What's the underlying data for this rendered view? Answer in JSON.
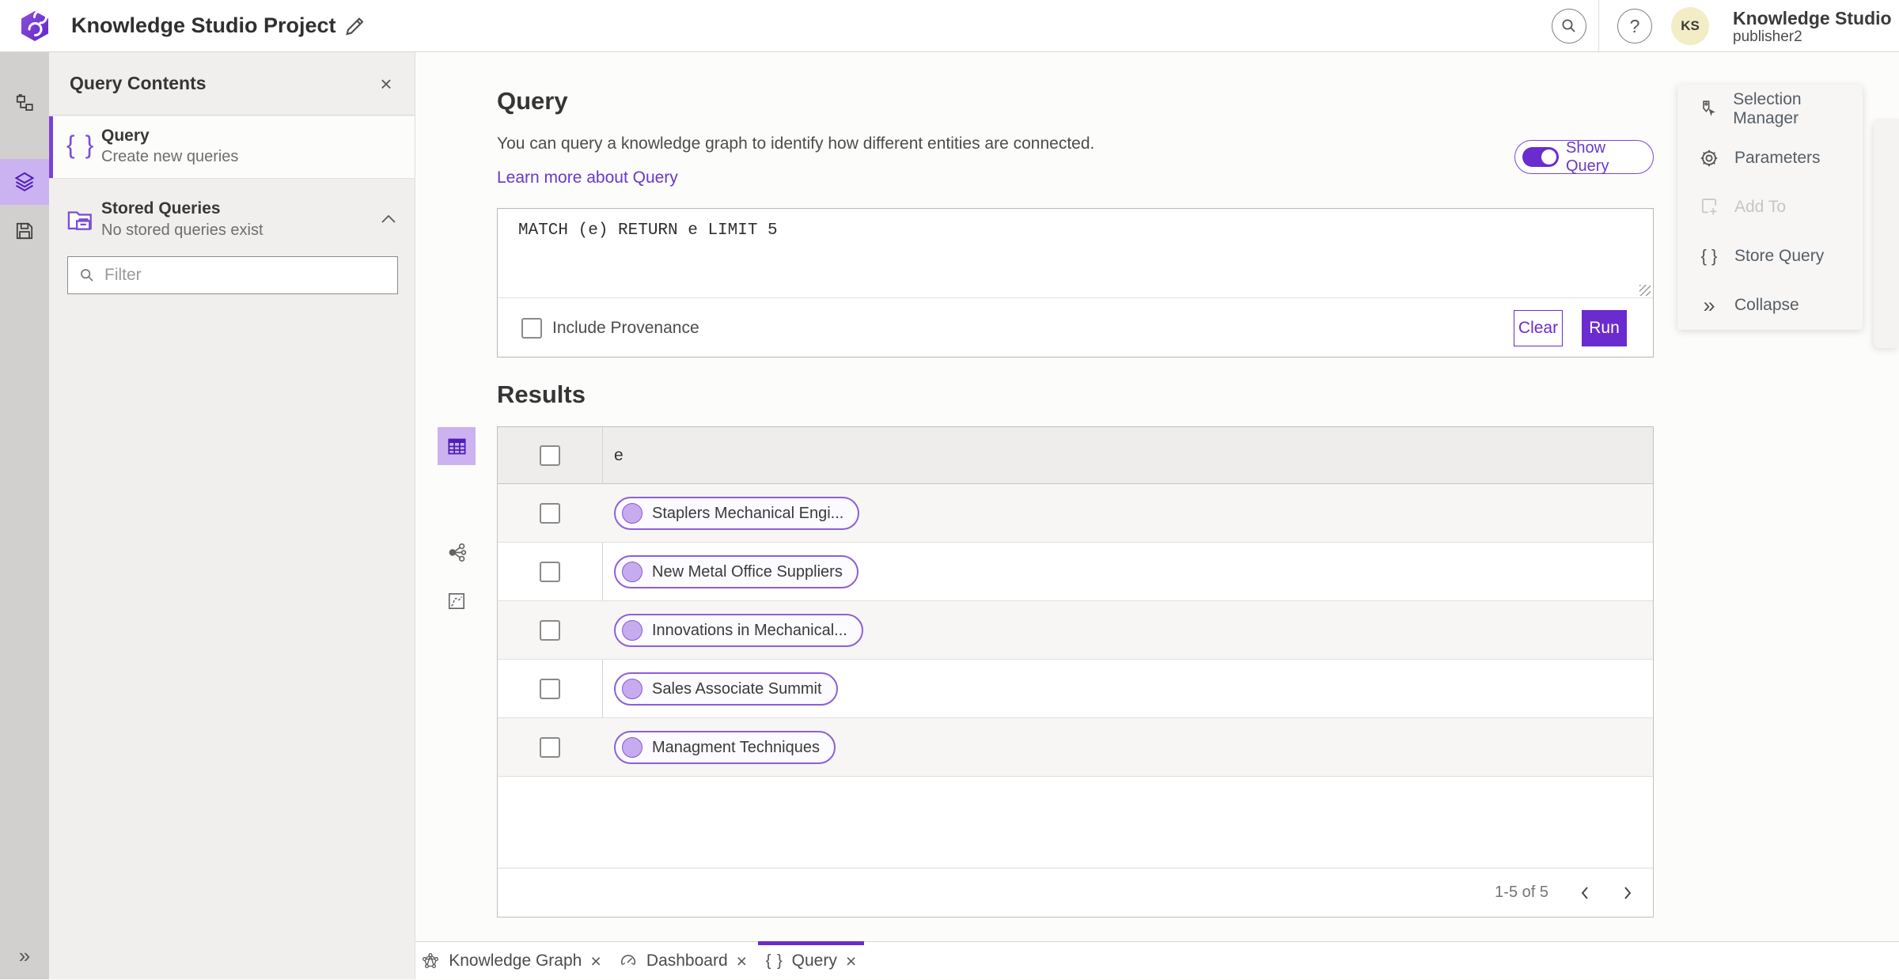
{
  "colors": {
    "brand_purple": "#6a2cce",
    "link_purple": "#6a38c8",
    "selected_tile_purple": "#cbb2f0",
    "pill_border_purple": "#8d5fd6",
    "avatar_yellow": "#f2edc4",
    "rail_gray": "#d2d0ce",
    "panel_gray": "#f1efee"
  },
  "icons": {
    "close": "×",
    "collapse_chevrons": "»",
    "braces": "{ }",
    "help": "?"
  },
  "header": {
    "app_title": "Knowledge Studio Project",
    "account_name": "Knowledge Studio",
    "account_user": "publisher2",
    "avatar_initials": "KS"
  },
  "contents_panel": {
    "title": "Query Contents",
    "query_item": {
      "title": "Query",
      "subtitle": "Create new queries"
    },
    "stored_item": {
      "title": "Stored Queries",
      "subtitle": "No stored queries exist"
    },
    "filter_placeholder": "Filter"
  },
  "query_section": {
    "title": "Query",
    "description": "You can query a knowledge graph to identify how different entities are connected.",
    "learn_more": "Learn more about Query",
    "show_query_label": "Show Query",
    "query_text": "MATCH (e) RETURN e LIMIT 5",
    "include_provenance_label": "Include Provenance",
    "clear_label": "Clear",
    "run_label": "Run"
  },
  "results": {
    "title": "Results",
    "column_header": "e",
    "rows": [
      {
        "label": "Staplers Mechanical Engi..."
      },
      {
        "label": "New Metal Office Suppliers"
      },
      {
        "label": "Innovations in Mechanical..."
      },
      {
        "label": "Sales Associate Summit"
      },
      {
        "label": "Managment Techniques"
      }
    ],
    "pagination": {
      "range_text": "1-5 of 5"
    }
  },
  "right_menu": {
    "items": [
      {
        "label": "Selection Manager"
      },
      {
        "label": "Parameters"
      },
      {
        "label": "Add To"
      },
      {
        "label": "Store Query"
      },
      {
        "label": "Collapse"
      }
    ]
  },
  "bottom_tabs": {
    "tabs": [
      {
        "label": "Knowledge Graph"
      },
      {
        "label": "Dashboard"
      },
      {
        "label": "Query"
      }
    ]
  }
}
